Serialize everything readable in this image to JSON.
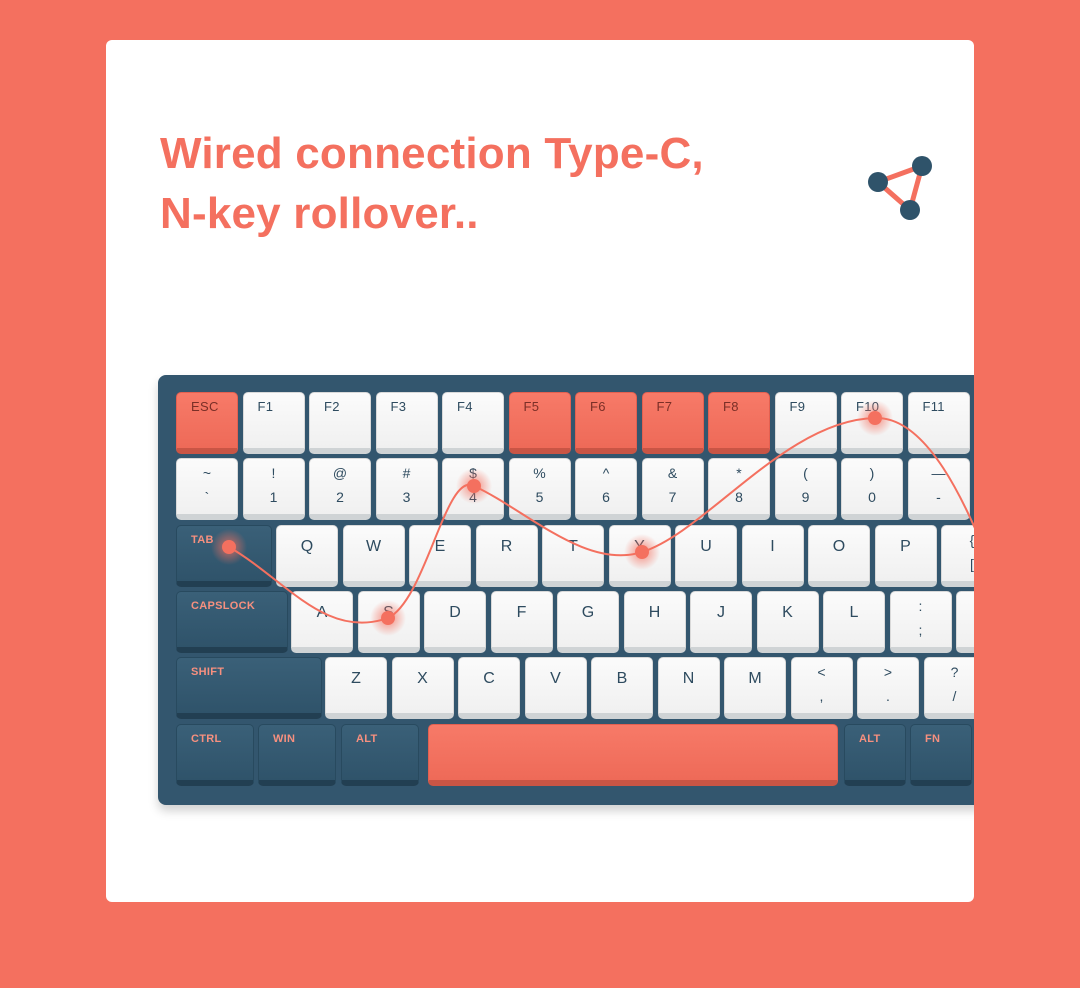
{
  "headline": {
    "line1": "Wired connection Type-C,",
    "line2": "N-key rollover.."
  },
  "icon": "network-share-icon",
  "colors": {
    "accent": "#f4705f",
    "keyboard_case": "#33566e",
    "key_white": "#f5f5f5",
    "key_blue": "#33566e"
  },
  "keyboard": {
    "function_row": [
      "ESC",
      "F1",
      "F2",
      "F3",
      "F4",
      "F5",
      "F6",
      "F7",
      "F8",
      "F9",
      "F10",
      "F11"
    ],
    "number_row": [
      {
        "top": "~",
        "bottom": "`"
      },
      {
        "top": "!",
        "bottom": "1"
      },
      {
        "top": "@",
        "bottom": "2"
      },
      {
        "top": "#",
        "bottom": "3"
      },
      {
        "top": "$",
        "bottom": "4"
      },
      {
        "top": "%",
        "bottom": "5"
      },
      {
        "top": "^",
        "bottom": "6"
      },
      {
        "top": "&",
        "bottom": "7"
      },
      {
        "top": "*",
        "bottom": "8"
      },
      {
        "top": "(",
        "bottom": "9"
      },
      {
        "top": ")",
        "bottom": "0"
      },
      {
        "top": "—",
        "bottom": "-"
      }
    ],
    "qwerty_row": {
      "mod": "TAB",
      "keys": [
        "Q",
        "W",
        "E",
        "R",
        "T",
        "Y",
        "U",
        "I",
        "O",
        "P"
      ],
      "last": {
        "top": "{",
        "bottom": "["
      }
    },
    "home_row": {
      "mod": "CAPSLOCK",
      "keys": [
        "A",
        "S",
        "D",
        "F",
        "G",
        "H",
        "J",
        "K",
        "L"
      ],
      "last": {
        "top": ":",
        "bottom": ";"
      }
    },
    "shift_row": {
      "mod": "SHIFT",
      "keys": [
        "Z",
        "X",
        "C",
        "V",
        "B",
        "N",
        "M"
      ],
      "extra": [
        {
          "top": "<",
          "bottom": ","
        },
        {
          "top": ">",
          "bottom": "."
        },
        {
          "top": "?",
          "bottom": "/"
        }
      ]
    },
    "bottom_row": {
      "left": [
        "CTRL",
        "WIN",
        "ALT"
      ],
      "right": [
        "ALT",
        "FN"
      ]
    }
  }
}
